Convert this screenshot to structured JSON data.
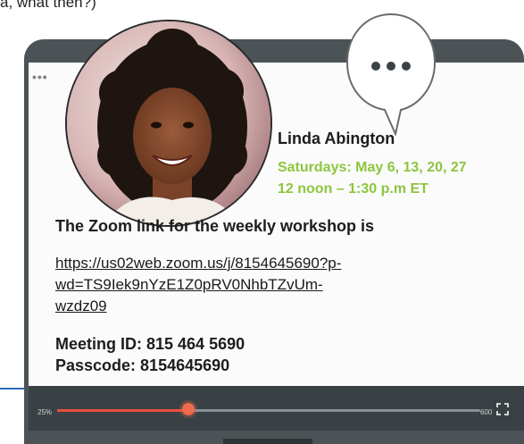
{
  "header_text": "a, what then?)",
  "presenter": {
    "name": "Linda Abington",
    "schedule_line1": "Saturdays: May 6, 13, 20, 27",
    "schedule_line2": "12 noon – 1:30 p.m ET"
  },
  "zoom": {
    "heading": "The Zoom link for the weekly workshop is",
    "link_line1": "https://us02web.zoom.us/j/8154645690?p-",
    "link_line2": "wd=TS9Iek9nYzE1Z0pRV0NhbTZvUm-",
    "link_line3": "wzdz09",
    "meeting_id": "Meeting ID: 815 464 5690",
    "passcode": "Passcode: 8154645690"
  },
  "player": {
    "elapsed": "25%",
    "duration": "600",
    "progress": 0.31
  },
  "icons": {
    "window_dots": "window-dots-icon",
    "bubble": "speech-bubble-icon",
    "fullscreen": "fullscreen-icon"
  },
  "colors": {
    "accent_green": "#8dc63f",
    "progress_red": "#e8503e",
    "frame": "#4b5356"
  }
}
